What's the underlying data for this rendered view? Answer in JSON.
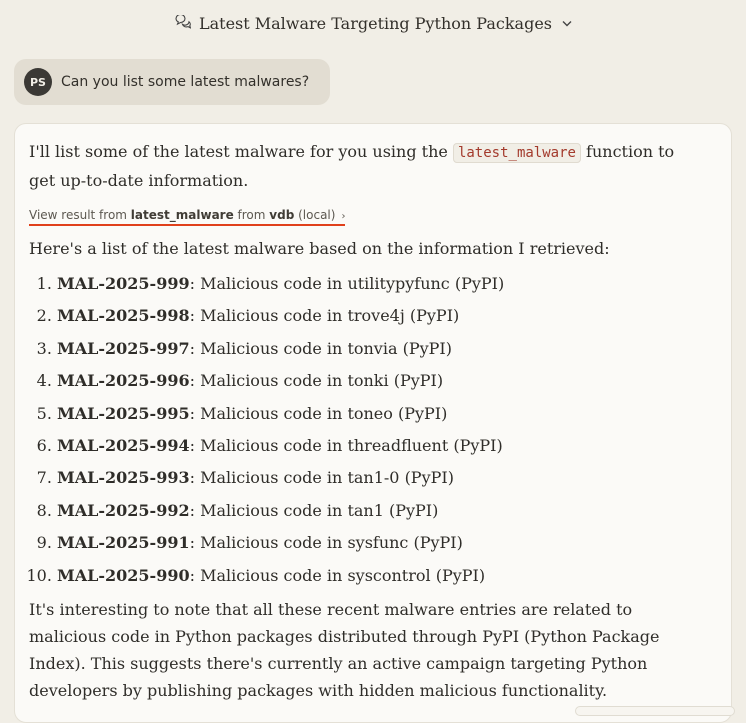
{
  "header": {
    "title": "Latest Malware Targeting Python Packages",
    "chat_icon": "chat-bubbles-icon",
    "chevron_icon": "chevron-down-icon"
  },
  "user_message": {
    "avatar_initials": "PS",
    "text": "Can you list some latest malwares?"
  },
  "assistant": {
    "intro_before": "I'll list some of the latest malware for you using the ",
    "intro_code": "latest_malware",
    "intro_after": " function to get up-to-date information.",
    "tool_result": {
      "prefix": "View result from ",
      "tool": "latest_malware",
      "from": " from ",
      "server": "vdb",
      "scope": " (local)",
      "chevron": "›"
    },
    "list_intro": "Here's a list of the latest malware based on the information I retrieved:",
    "items": [
      {
        "id": "MAL-2025-999",
        "desc": ": Malicious code in utilitypyfunc (PyPI)"
      },
      {
        "id": "MAL-2025-998",
        "desc": ": Malicious code in trove4j (PyPI)"
      },
      {
        "id": "MAL-2025-997",
        "desc": ": Malicious code in tonvia (PyPI)"
      },
      {
        "id": "MAL-2025-996",
        "desc": ": Malicious code in tonki (PyPI)"
      },
      {
        "id": "MAL-2025-995",
        "desc": ": Malicious code in toneo (PyPI)"
      },
      {
        "id": "MAL-2025-994",
        "desc": ": Malicious code in threadfluent (PyPI)"
      },
      {
        "id": "MAL-2025-993",
        "desc": ": Malicious code in tan1-0 (PyPI)"
      },
      {
        "id": "MAL-2025-992",
        "desc": ": Malicious code in tan1 (PyPI)"
      },
      {
        "id": "MAL-2025-991",
        "desc": ": Malicious code in sysfunc (PyPI)"
      },
      {
        "id": "MAL-2025-990",
        "desc": ": Malicious code in syscontrol (PyPI)"
      }
    ],
    "closing": "It's interesting to note that all these recent malware entries are related to malicious code in Python packages distributed through PyPI (Python Package Index). This suggests there's currently an active campaign targeting Python developers by publishing packages with hidden malicious functionality."
  },
  "colors": {
    "background": "#f1eee6",
    "user_bubble": "#e2ddd2",
    "card": "#fbfaf7",
    "code_text": "#a33a2c",
    "highlight_underline": "#e0401b"
  }
}
